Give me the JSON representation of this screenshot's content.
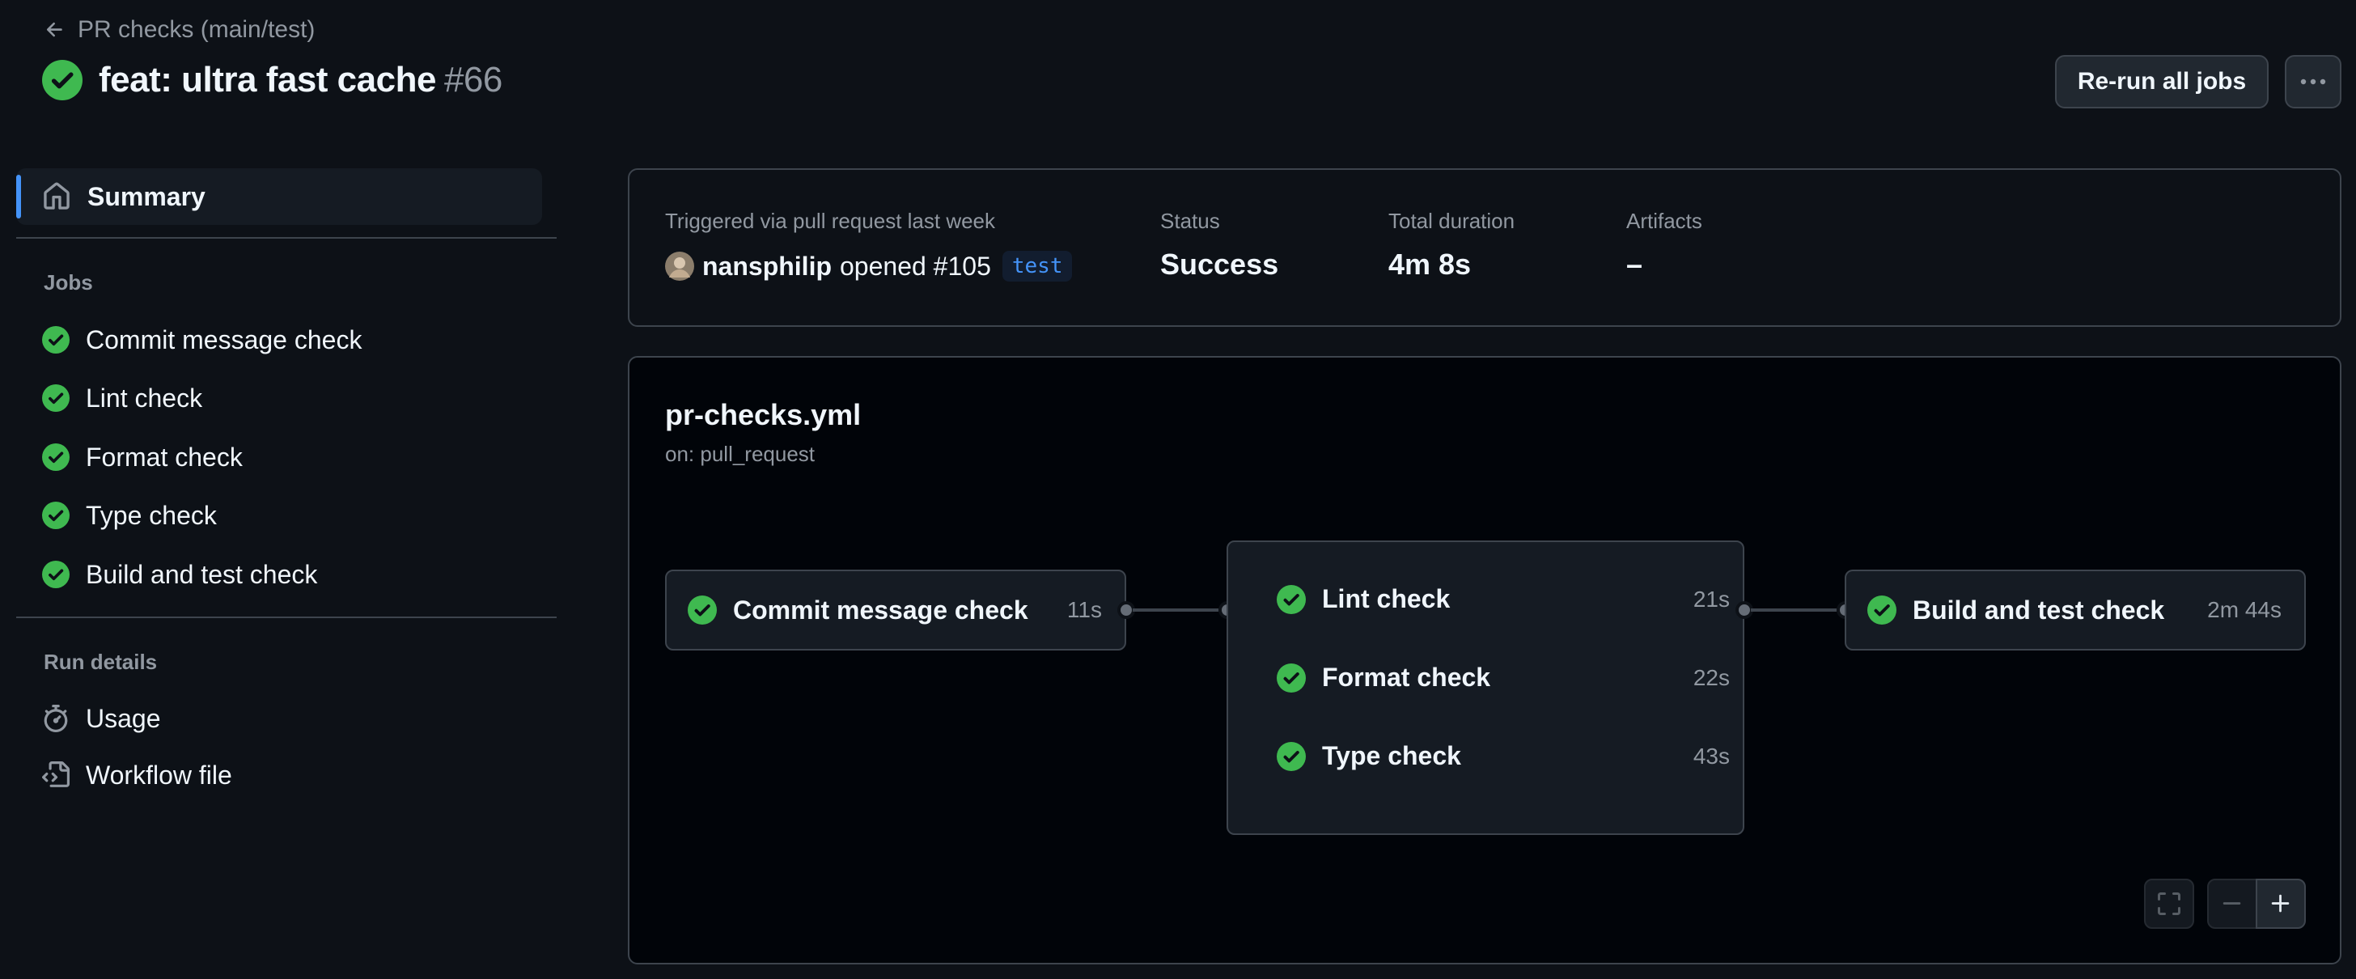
{
  "header": {
    "back_label": "PR checks (main/test)",
    "title": "feat: ultra fast cache",
    "run_number": "#66",
    "rerun_label": "Re-run all jobs"
  },
  "sidebar": {
    "summary_label": "Summary",
    "jobs_heading": "Jobs",
    "jobs": [
      {
        "label": "Commit message check"
      },
      {
        "label": "Lint check"
      },
      {
        "label": "Format check"
      },
      {
        "label": "Type check"
      },
      {
        "label": "Build and test check"
      }
    ],
    "run_details_heading": "Run details",
    "run_details": [
      {
        "label": "Usage",
        "icon": "stopwatch-icon"
      },
      {
        "label": "Workflow file",
        "icon": "file-code-icon"
      }
    ]
  },
  "summary": {
    "trigger_label": "Triggered via pull request last week",
    "actor": "nansphilip",
    "action": "opened #105",
    "branch": "test",
    "status_label": "Status",
    "status_value": "Success",
    "duration_label": "Total duration",
    "duration_value": "4m 8s",
    "artifacts_label": "Artifacts",
    "artifacts_value": "–"
  },
  "workflow": {
    "file": "pr-checks.yml",
    "trigger": "on: pull_request",
    "stage1": [
      {
        "name": "Commit message check",
        "duration": "11s"
      }
    ],
    "stage2": [
      {
        "name": "Lint check",
        "duration": "21s"
      },
      {
        "name": "Format check",
        "duration": "22s"
      },
      {
        "name": "Type check",
        "duration": "43s"
      }
    ],
    "stage3": [
      {
        "name": "Build and test check",
        "duration": "2m 44s"
      }
    ]
  },
  "colors": {
    "success": "#3fb950",
    "accent": "#4493f8",
    "background": "#0d1117"
  }
}
